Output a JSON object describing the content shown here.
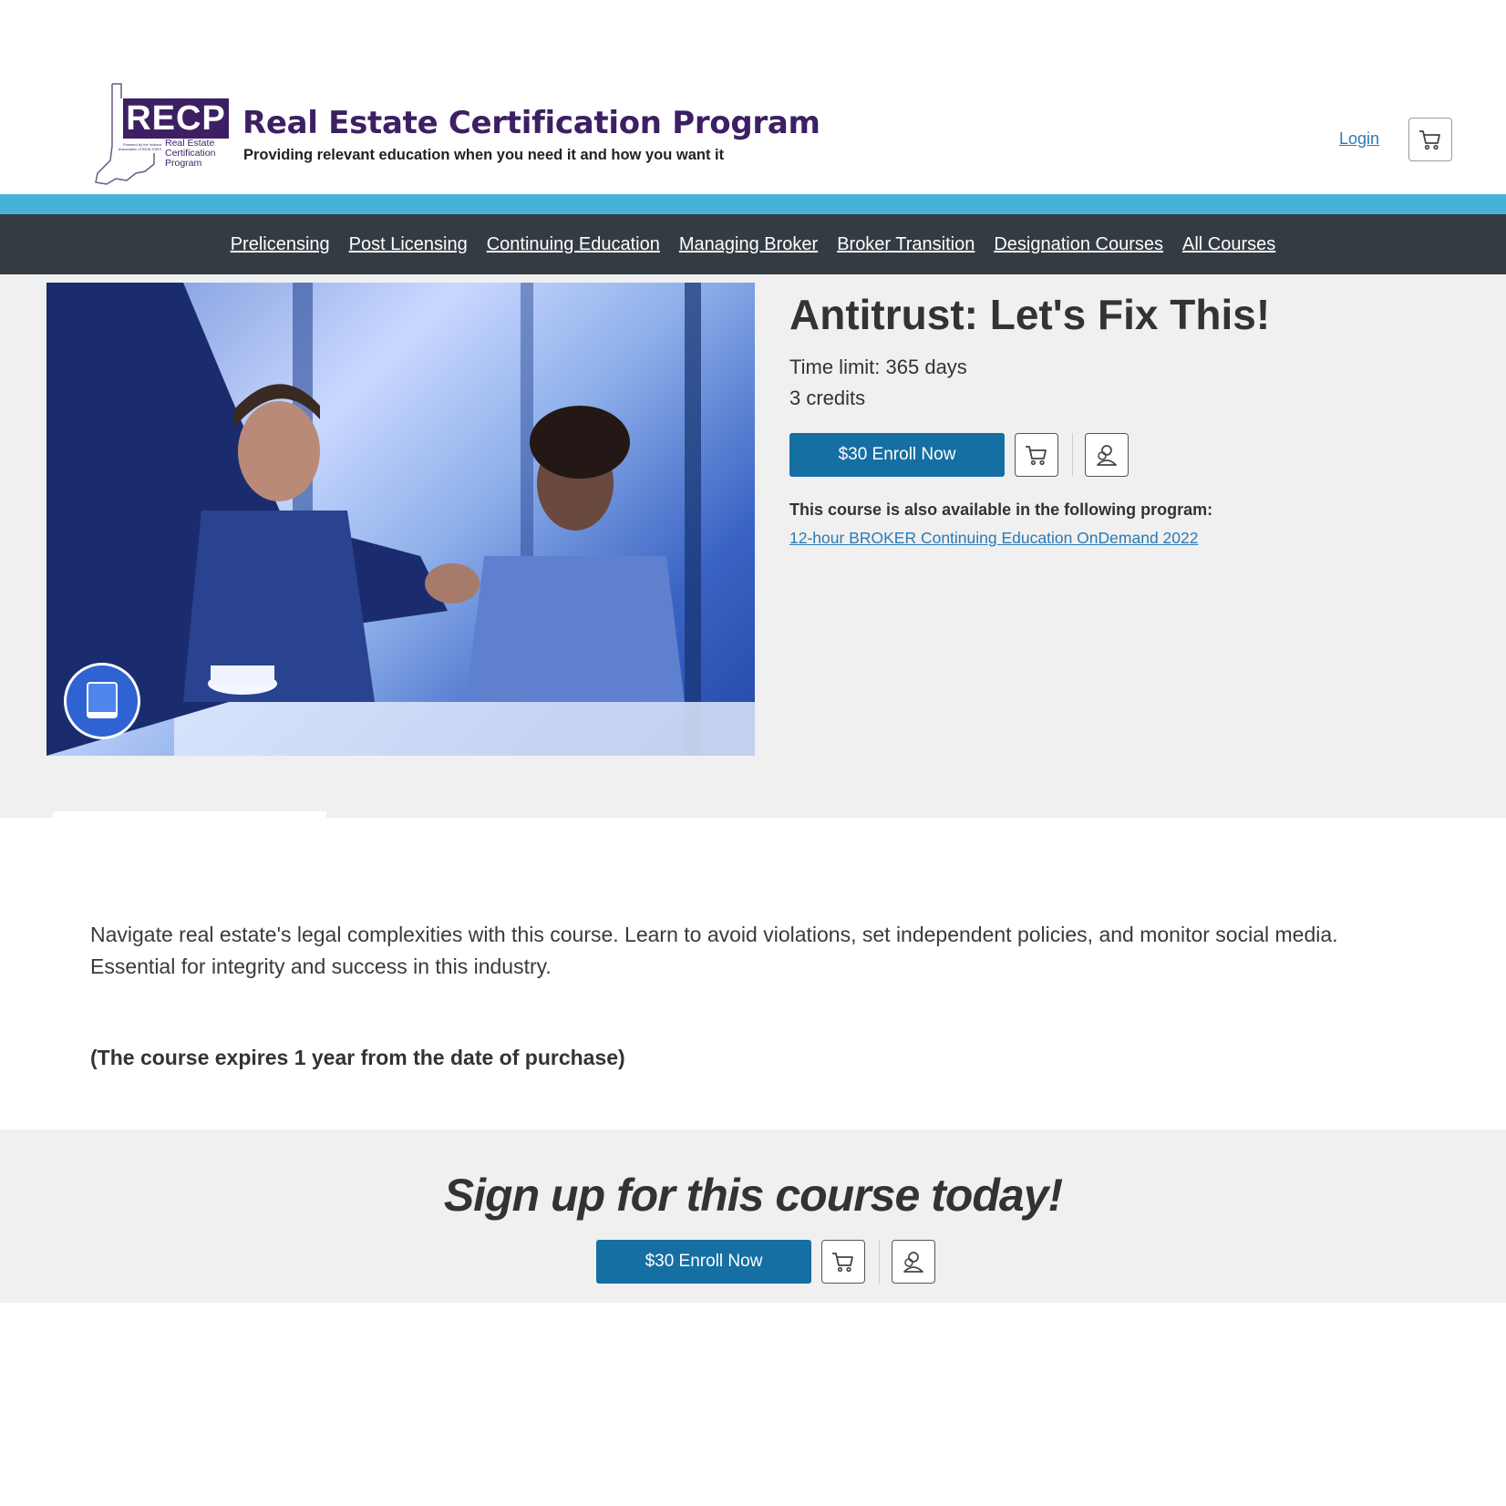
{
  "brand": {
    "logo_abbr": "RECP",
    "logo_subtitle": "Real Estate Certification Program",
    "logo_tiny": "Powered by the Indiana Association of REALTORS",
    "title": "Real Estate Certification Program",
    "tagline": "Providing relevant education when you need it and how you want it",
    "color": "#3d1f63"
  },
  "header": {
    "login_label": "Login",
    "cart_icon": "cart-icon"
  },
  "nav": {
    "items": [
      {
        "label": "Prelicensing"
      },
      {
        "label": "Post Licensing"
      },
      {
        "label": "Continuing Education"
      },
      {
        "label": "Managing Broker"
      },
      {
        "label": "Broker Transition"
      },
      {
        "label": "Designation Courses"
      },
      {
        "label": "All Courses"
      }
    ],
    "accent_color": "#46b3d6",
    "background_color": "#343c43"
  },
  "course": {
    "title": "Antitrust: Let's Fix This!",
    "time_limit": "Time limit: 365 days",
    "credits": "3 credits",
    "enroll_label": "$30 Enroll Now",
    "badge_icon": "book-icon",
    "available_label": "This course is also available in the following program:",
    "program_link": "12-hour BROKER Continuing Education OnDemand 2022",
    "button_color": "#166fa3"
  },
  "description": {
    "text": "Navigate real estate's legal complexities with this course. Learn to avoid violations, set independent policies, and monitor social media. Essential for integrity and success in this industry.",
    "expires_note": "(The course expires 1 year from the date of purchase)"
  },
  "cta": {
    "title": "Sign up for this course today!",
    "enroll_label": "$30 Enroll Now"
  }
}
